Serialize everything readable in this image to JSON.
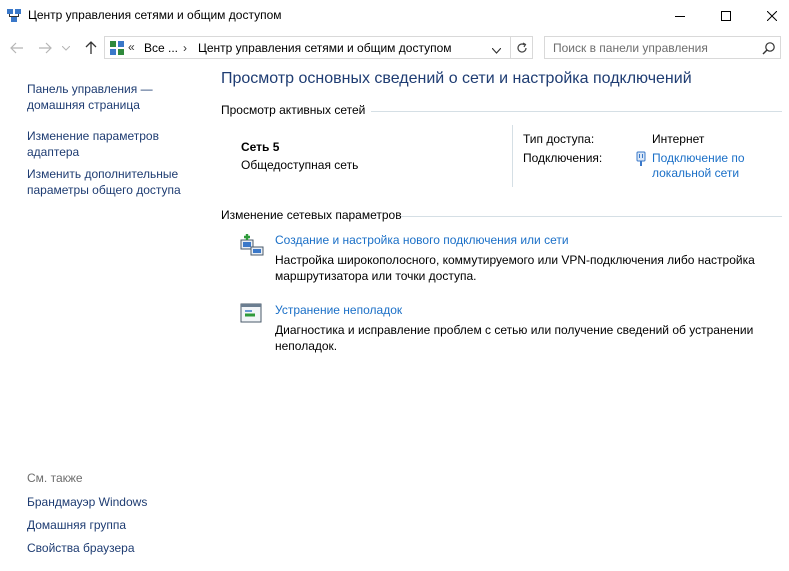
{
  "window": {
    "title": "Центр управления сетями и общим доступом",
    "minimize_icon": "minimize-icon",
    "maximize_icon": "maximize-icon",
    "close_icon": "close-icon"
  },
  "address": {
    "overflow": "«",
    "crumbs": [
      "Все ...",
      "Центр управления сетями и общим доступом"
    ],
    "search_placeholder": "Поиск в панели управления"
  },
  "sidebar": {
    "links": [
      "Панель управления — домашняя страница",
      "Изменение параметров адаптера",
      "Изменить дополнительные параметры общего доступа"
    ],
    "see_also_title": "См. также",
    "see_also": [
      "Брандмауэр Windows",
      "Домашняя группа",
      "Свойства браузера"
    ]
  },
  "main": {
    "title": "Просмотр основных сведений о сети и настройка подключений",
    "active_networks_header": "Просмотр активных сетей",
    "network": {
      "name": "Сеть  5",
      "category": "Общедоступная сеть",
      "access_label": "Тип доступа:",
      "access_value": "Интернет",
      "connections_label": "Подключения:",
      "connection_link": "Подключение по локальной сети"
    },
    "change_header": "Изменение сетевых параметров",
    "tasks": [
      {
        "link": "Создание и настройка нового подключения или сети",
        "desc": "Настройка широкополосного, коммутируемого или VPN-подключения либо настройка маршрутизатора или точки доступа."
      },
      {
        "link": "Устранение неполадок",
        "desc": "Диагностика и исправление проблем с сетью или получение сведений об устранении неполадок."
      }
    ]
  },
  "colors": {
    "link": "#1a6fc7",
    "heading": "#1e3c72",
    "muted": "#6d6d6d",
    "rule": "#d5dfe5"
  }
}
